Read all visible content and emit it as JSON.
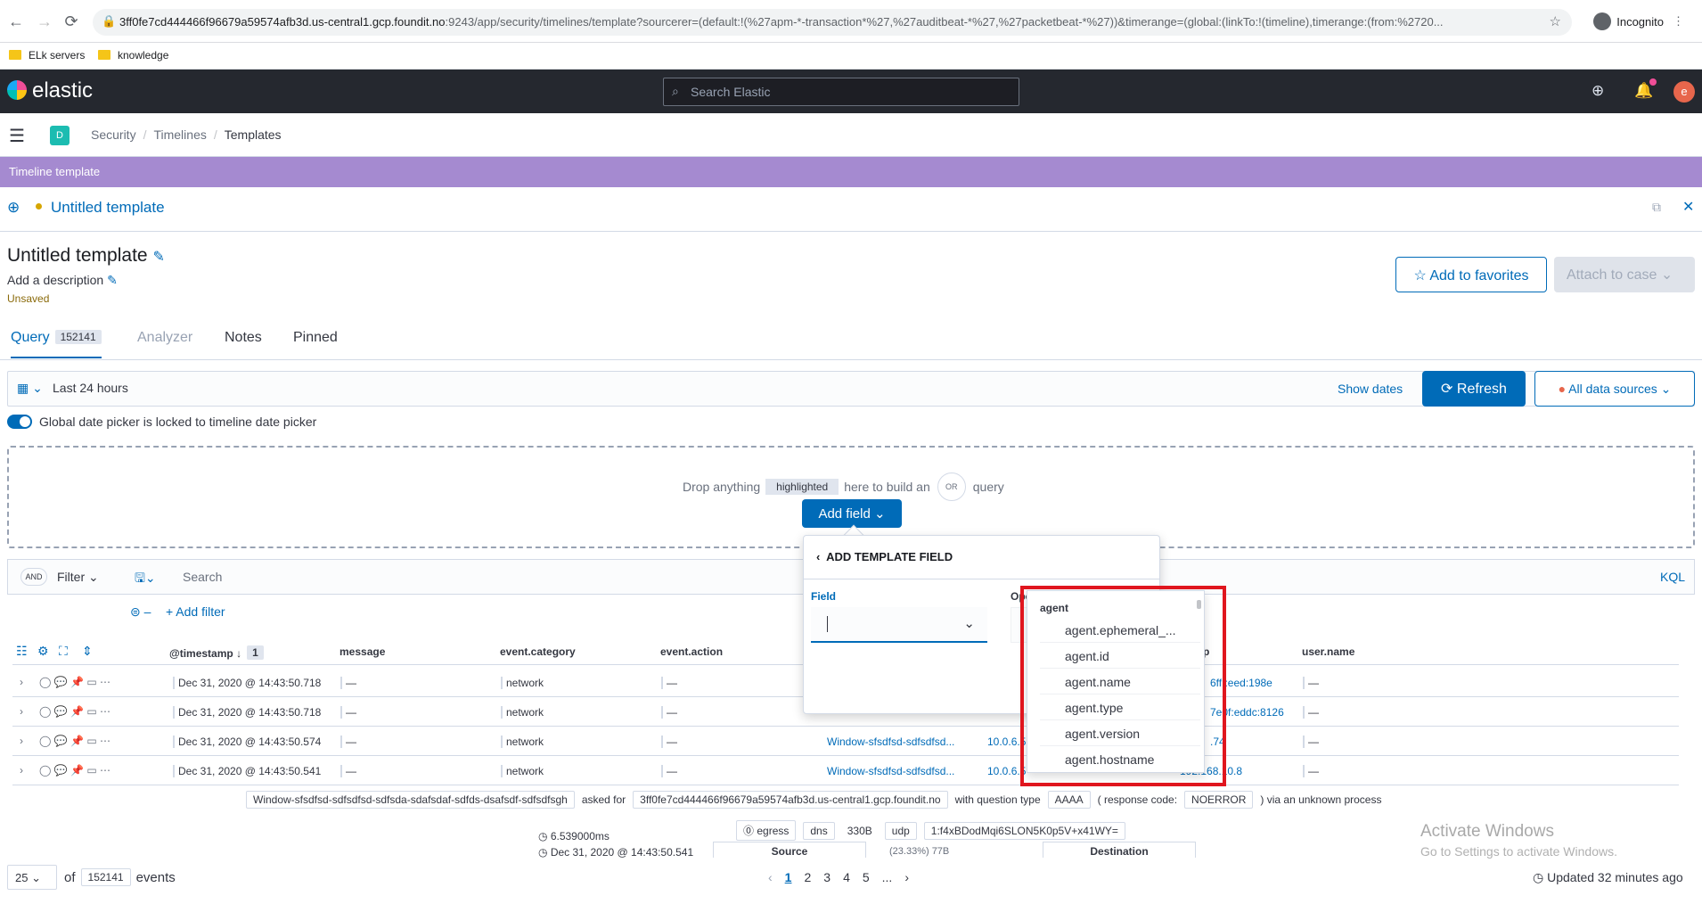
{
  "browser": {
    "url_main": "3ff0fe7cd444466f96679a59574afb3d.us-central1.gcp.foundit.no",
    "url_rest": ":9243/app/security/timelines/template?sourcerer=(default:!(%27apm-*-transaction*%27,%27auditbeat-*%27,%27packetbeat-*%27))&timerange=(global:(linkTo:!(timeline),timerange:(from:%2720...",
    "profile_label": "Incognito",
    "bookmarks": [
      "ELk servers",
      "knowledge"
    ]
  },
  "header": {
    "brand": "elastic",
    "search_placeholder": "Search Elastic",
    "avatar_initial": "e"
  },
  "breadcrumbs": {
    "space_initial": "D",
    "items": [
      "Security",
      "Timelines",
      "Templates"
    ]
  },
  "template_strip": "Timeline template",
  "flyout": {
    "tab_title": "Untitled template",
    "title": "Untitled template",
    "description_placeholder": "Add a description",
    "status": "Unsaved",
    "add_favorites": "Add to favorites",
    "attach_case": "Attach to case"
  },
  "tabs": [
    {
      "label": "Query",
      "badge": "152141"
    },
    {
      "label": "Analyzer"
    },
    {
      "label": "Notes"
    },
    {
      "label": "Pinned"
    }
  ],
  "date_picker": {
    "range": "Last 24 hours",
    "show_dates": "Show dates",
    "refresh": "Refresh",
    "data_sources": "All data sources",
    "lock_label": "Global date picker is locked to timeline date picker"
  },
  "dropzone": {
    "pre": "Drop anything",
    "highlight": "highlighted",
    "mid": "here to build an",
    "or": "OR",
    "post": "query",
    "add_field": "Add field"
  },
  "query_bar": {
    "and": "AND",
    "filter": "Filter",
    "search_placeholder": "Search",
    "kql": "KQL",
    "add_filter": "+ Add filter"
  },
  "popover": {
    "title": "ADD TEMPLATE FIELD",
    "field_label": "Field",
    "operator_label": "Ope"
  },
  "combo_options": {
    "group": "agent",
    "items": [
      "agent.ephemeral_...",
      "agent.id",
      "agent.name",
      "agent.type",
      "agent.version",
      "agent.hostname"
    ]
  },
  "table": {
    "columns": [
      "@timestamp",
      "message",
      "event.category",
      "event.action",
      "p",
      "user.name"
    ],
    "sort_count": "1",
    "rows": [
      {
        "timestamp": "Dec 31, 2020 @ 14:43:50.718",
        "message": "—",
        "category": "network",
        "action": "—",
        "host": "",
        "ip": "",
        "dest": "6ff::eed:198e",
        "user": "—"
      },
      {
        "timestamp": "Dec 31, 2020 @ 14:43:50.718",
        "message": "—",
        "category": "network",
        "action": "—",
        "host": "",
        "ip": "",
        "dest": "7e0f:eddc:8126",
        "user": "—"
      },
      {
        "timestamp": "Dec 31, 2020 @ 14:43:50.574",
        "message": "—",
        "category": "network",
        "action": "—",
        "host": "Window-sfsdfsd-sdfsdfsd...",
        "ip": "10.0.6.5",
        "dest": ".74",
        "user": "—"
      },
      {
        "timestamp": "Dec 31, 2020 @ 14:43:50.541",
        "message": "—",
        "category": "network",
        "action": "—",
        "host": "Window-sfsdfsd-sdfsdfsd...",
        "ip": "10.0.6.5",
        "dest": "192.168.10.8",
        "user": "—"
      }
    ]
  },
  "row_detail": {
    "host_full": "Window-sfsdfsd-sdfsdfsd-sdfsda-sdafsdaf-sdfds-dsafsdf-sdfsdfsgh",
    "asked_for": "asked for",
    "domain": "3ff0fe7cd444466f96679a59574afb3d.us-central1.gcp.foundit.no",
    "with_qtype": "with question type",
    "qtype": "AAAA",
    "resp_label": "( response code:",
    "resp": "NOERROR",
    "via": ") via an unknown process",
    "duration": "6.539000ms",
    "ts": "Dec 31, 2020 @ 14:43:50.541",
    "direction": "egress",
    "proto": "dns",
    "bytes": "330B",
    "transport": "udp",
    "community_id": "1:f4xBDodMqi6SLON5K0p5V+x41WY=",
    "source": "Source",
    "destination": "Destination",
    "pct": "(23.33%) 77B"
  },
  "footer": {
    "per_page": "25",
    "of": "of",
    "total": "152141",
    "events": "events",
    "pages": [
      "1",
      "2",
      "3",
      "4",
      "5",
      "..."
    ],
    "updated": "Updated 32 minutes ago"
  },
  "watermark": {
    "line1": "Activate Windows",
    "line2": "Go to Settings to activate Windows."
  }
}
